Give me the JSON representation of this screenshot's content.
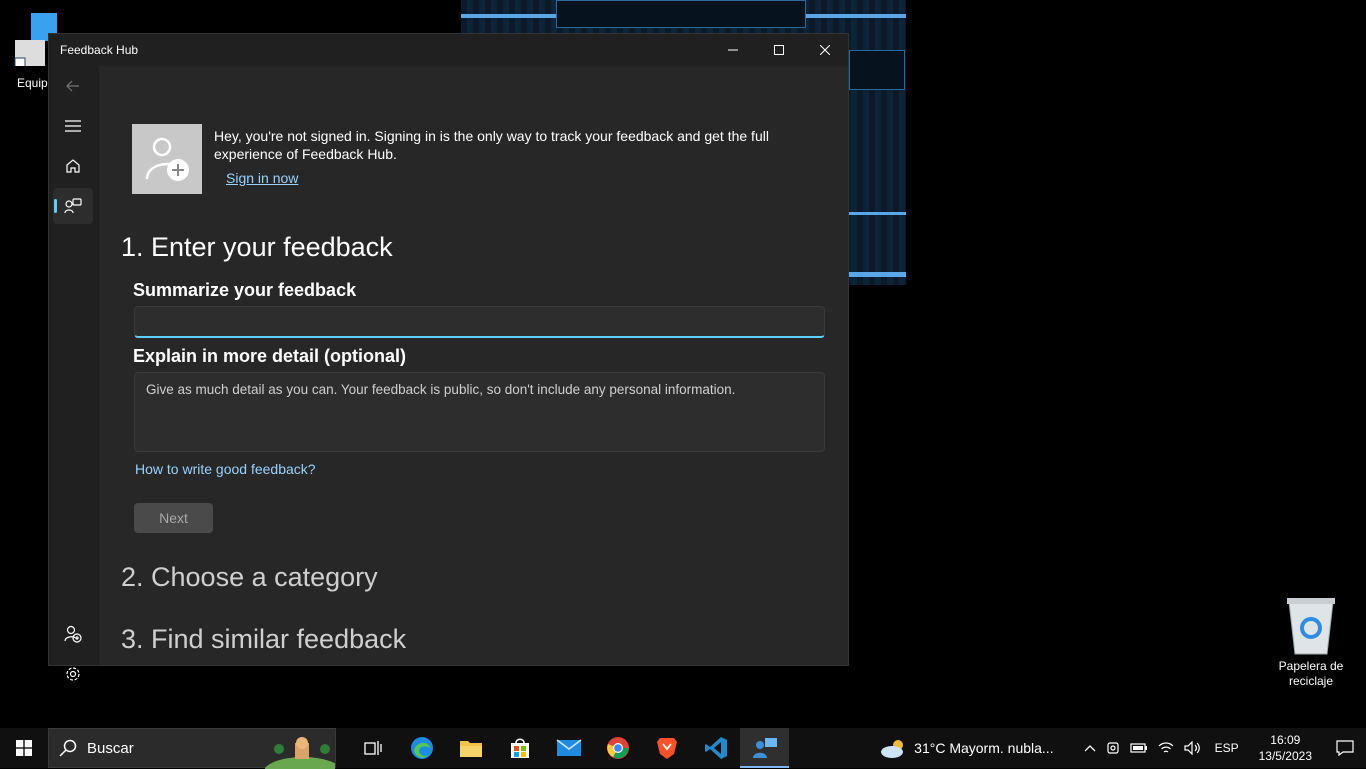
{
  "desktop": {
    "icons": [
      {
        "label": "Equip"
      },
      {
        "label": "Papelera de reciclaje"
      }
    ]
  },
  "window": {
    "title": "Feedback Hub"
  },
  "signin": {
    "message": "Hey, you're not signed in. Signing in is the only way to track your feedback and get the full experience of Feedback Hub.",
    "link": "Sign in now"
  },
  "form": {
    "step1": "1. Enter your feedback",
    "summary_label": "Summarize your feedback",
    "summary_value": "",
    "detail_label": "Explain in more detail (optional)",
    "detail_placeholder": "Give as much detail as you can. Your feedback is public, so don't include any personal information.",
    "help_link": "How to write good feedback?",
    "next_label": "Next",
    "step2": "2. Choose a category",
    "step3": "3. Find similar feedback"
  },
  "taskbar": {
    "search_placeholder": "Buscar",
    "weather": "31°C  Mayorm. nubla...",
    "language": "ESP",
    "time": "16:09",
    "date": "13/5/2023"
  },
  "colors": {
    "accent": "#60cdff",
    "link": "#99d1ff"
  }
}
